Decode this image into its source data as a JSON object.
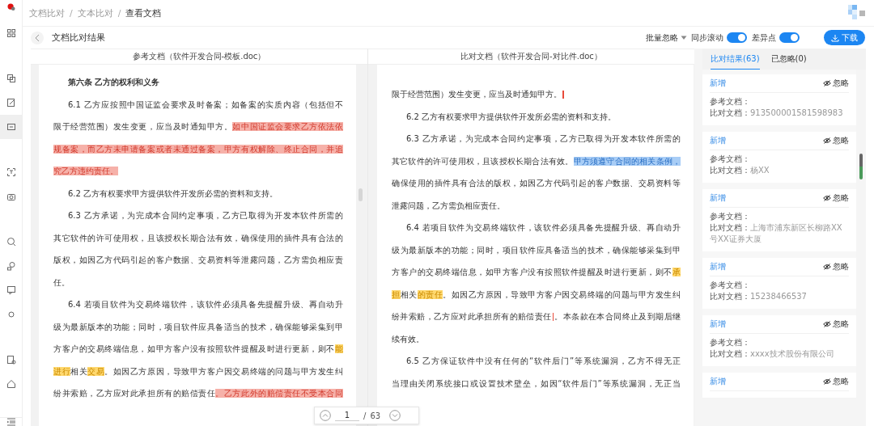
{
  "sidebar": {
    "groups": [
      {
        "items": [
          {
            "selected": false
          }
        ]
      },
      {
        "items": [
          {
            "selected": false
          },
          {
            "selected": false
          },
          {
            "selected": true
          }
        ]
      },
      {
        "items": [
          {
            "selected": false
          },
          {
            "selected": false
          }
        ]
      },
      {
        "items": [
          {
            "selected": false
          },
          {
            "selected": false
          },
          {
            "selected": false
          },
          {
            "selected": false
          }
        ]
      },
      {
        "items": [
          {
            "selected": false
          },
          {
            "selected": false
          }
        ]
      }
    ]
  },
  "breadcrumb": [
    {
      "label": "文档比对",
      "current": false
    },
    {
      "label": "文本比对",
      "current": false
    },
    {
      "label": "查看文档",
      "current": true
    }
  ],
  "breadcrumb_separator": "/",
  "toolbar": {
    "title": "文档比对结果",
    "batch_ignore": "批量忽略",
    "toggles": [
      {
        "label": "同步滚动",
        "on": true
      },
      {
        "label": "差异点",
        "on": true
      }
    ],
    "download": "下载"
  },
  "documents": [
    {
      "header": "参考文档（软件开发合同-模板.doc）",
      "lines": [
        {
          "kind": "heading",
          "segments": [
            {
              "text": "第六条 乙方的权利和义务"
            }
          ]
        },
        {
          "kind": "start",
          "segments": [
            {
              "text": "6.1 乙方应按照中国证监会要求及时备案；如备案的实质内容（包括但不"
            }
          ]
        },
        {
          "kind": "line",
          "segments": [
            {
              "text": "限于经营范围）发生变更，应当及时通知甲方。"
            },
            {
              "text": "如中国证监会要求乙方依法依",
              "kind": "deleted"
            }
          ]
        },
        {
          "kind": "line",
          "segments": [
            {
              "text": "规备案，而乙方未申请备案或者未通过备案，甲方有权解除、终止合同，并追",
              "kind": "deleted"
            }
          ]
        },
        {
          "kind": "end",
          "segments": [
            {
              "text": "究乙方违约责任。",
              "kind": "deleted"
            }
          ]
        },
        {
          "kind": "single",
          "segments": [
            {
              "text": "6.2 乙方有权要求甲方提供软件开发所必需的资料和支持。"
            }
          ]
        },
        {
          "kind": "start",
          "segments": [
            {
              "text": "6.3 乙方承诺，为完成本合同约定事项，乙方已取得为开发本软件所需的"
            }
          ]
        },
        {
          "kind": "line",
          "segments": [
            {
              "text": "其它软件的许可使用权，且该授权长期合法有效，确保使用的插件具有合法的"
            }
          ]
        },
        {
          "kind": "line",
          "segments": [
            {
              "text": "版权，如因乙方代码引起的客户数据、交易资料等泄露问题，乙方需负相应责"
            }
          ]
        },
        {
          "kind": "end",
          "segments": [
            {
              "text": "任。"
            }
          ]
        },
        {
          "kind": "start",
          "segments": [
            {
              "text": "6.4 若项目软件为交易终端软件，该软件必须具备先提醒升级、再自动升"
            }
          ]
        },
        {
          "kind": "line",
          "segments": [
            {
              "text": "级为最新版本的功能；同时，项目软件应具备适当的技术，确保能够采集到甲"
            }
          ]
        },
        {
          "kind": "line",
          "segments": [
            {
              "text": "方客户的交易终端信息，如甲方客户没有按照软件提醒及时进行更新，则不"
            },
            {
              "text": "能",
              "kind": "changed"
            }
          ]
        },
        {
          "kind": "line",
          "segments": [
            {
              "text": "进行",
              "kind": "changed"
            },
            {
              "text": "相关"
            },
            {
              "text": "交易",
              "kind": "changed"
            },
            {
              "text": "。如因乙方原因，导致甲方客户因交易终端的问题与甲方发生纠"
            }
          ]
        },
        {
          "kind": "line",
          "segments": [
            {
              "text": "纷并索赔，乙方应对此承担所有的赔偿责任"
            },
            {
              "text": "。乙方此外的赔偿责任不受本合同",
              "kind": "deleted"
            }
          ]
        }
      ]
    },
    {
      "header": "比对文档（软件开发合同-对比件.doc）",
      "lines": [
        {
          "kind": "end",
          "segments": [
            {
              "text": "限于经营范围）发生变更，应当及时通知甲方。"
            },
            {
              "kind": "caret"
            }
          ]
        },
        {
          "kind": "single",
          "segments": [
            {
              "text": "6.2 乙方有权要求甲方提供软件开发所必需的资料和支持。"
            }
          ]
        },
        {
          "kind": "start",
          "segments": [
            {
              "text": "6.3 乙方承诺，为完成本合同约定事项，乙方已取得为开发本软件所需的"
            }
          ]
        },
        {
          "kind": "line",
          "segments": [
            {
              "text": "其它软件的许可使用权，且该授权长期合法有效。"
            },
            {
              "text": "甲方须遵守合同的相关条例，",
              "kind": "added"
            }
          ]
        },
        {
          "kind": "line",
          "segments": [
            {
              "text": "确保使用的插件具有合法的版权，如因乙方代码引起的客户数据、交易资料等"
            }
          ]
        },
        {
          "kind": "end",
          "segments": [
            {
              "text": "泄露问题，乙方需负相应责任。"
            }
          ]
        },
        {
          "kind": "start",
          "segments": [
            {
              "text": "6.4 若项目软件为交易终端软件，该软件必须具备先提醒升级、再自动升"
            }
          ]
        },
        {
          "kind": "line",
          "segments": [
            {
              "text": "级为最新版本的功能；同时，项目软件应具备适当的技术，确保能够采集到甲"
            }
          ]
        },
        {
          "kind": "line",
          "segments": [
            {
              "text": "方客户的交易终端信息，如甲方客户没有按照软件提醒及时进行更新，则不"
            },
            {
              "text": "承",
              "kind": "changed"
            }
          ]
        },
        {
          "kind": "line",
          "segments": [
            {
              "text": "担",
              "kind": "changed"
            },
            {
              "text": "相关"
            },
            {
              "text": "的责任",
              "kind": "changed"
            },
            {
              "text": "。如因乙方原因，导致甲方客户因交易终端的问题与甲方发生纠"
            }
          ]
        },
        {
          "kind": "line",
          "segments": [
            {
              "text": "纷并索赔，乙方应对此承担所有的赔偿责任"
            },
            {
              "kind": "caret"
            },
            {
              "text": "。本条款在本合同终止及到期后继"
            }
          ]
        },
        {
          "kind": "end",
          "segments": [
            {
              "text": "续有效。"
            }
          ]
        },
        {
          "kind": "start",
          "segments": [
            {
              "text": "6.5 乙方保证软件中没有任何的“软件后门”等系统漏洞，乙方不得无正"
            }
          ]
        },
        {
          "kind": "line",
          "segments": [
            {
              "text": "当理由关闭系统接口或设置技术壁垒，如因“软件后门”等系统漏洞，无正当"
            }
          ]
        }
      ]
    }
  ],
  "pager": {
    "page": "1",
    "separator": "/",
    "total": "63"
  },
  "results": {
    "tabs": [
      {
        "label": "比对结果(63)",
        "selected": true
      },
      {
        "label": "已忽略(0)",
        "selected": false
      }
    ],
    "cards": [
      {
        "type": "新增",
        "ignore": "忽略",
        "reference_label": "参考文档：",
        "compare_label": "比对文档：",
        "compare_value": "913500001581598983"
      },
      {
        "type": "新增",
        "ignore": "忽略",
        "reference_label": "参考文档：",
        "compare_label": "比对文档：",
        "compare_value": "杨XX"
      },
      {
        "type": "新增",
        "ignore": "忽略",
        "reference_label": "参考文档：",
        "compare_label": "比对文档：",
        "compare_value": "上海市浦东新区长柳路XX号XX证券大厦"
      },
      {
        "type": "新增",
        "ignore": "忽略",
        "reference_label": "参考文档：",
        "compare_label": "比对文档：",
        "compare_value": "15238466537"
      },
      {
        "type": "新增",
        "ignore": "忽略",
        "reference_label": "参考文档：",
        "compare_label": "比对文档：",
        "compare_value": "xxxx技术股份有限公司"
      },
      {
        "type": "新增",
        "ignore": "忽略"
      }
    ]
  }
}
